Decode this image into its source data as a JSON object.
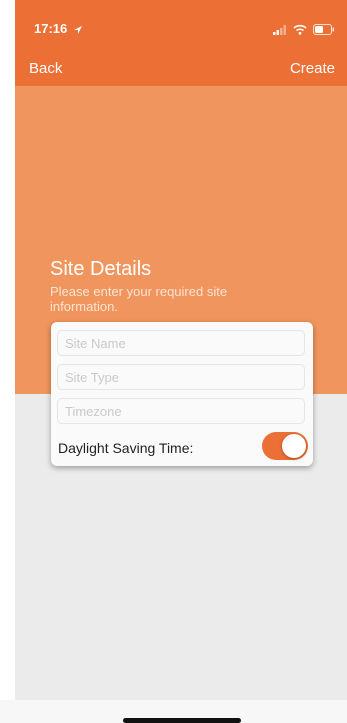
{
  "status_bar": {
    "time": "17:16",
    "background": "#ec6f35"
  },
  "nav": {
    "back_label": "Back",
    "create_label": "Create"
  },
  "hero": {
    "title": "Site Details",
    "subtitle": "Please enter your required site information.",
    "background": "#f0955d"
  },
  "form": {
    "site_name": {
      "placeholder": "Site Name",
      "value": ""
    },
    "site_type": {
      "placeholder": "Site Type",
      "value": ""
    },
    "timezone": {
      "placeholder": "Timezone",
      "value": ""
    },
    "dst": {
      "label": "Daylight Saving Time:",
      "enabled": true,
      "color": "#ec6f35"
    }
  }
}
